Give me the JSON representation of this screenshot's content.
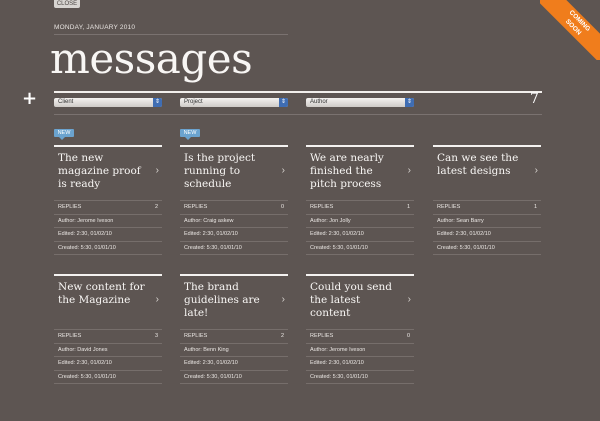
{
  "close_label": "CLOSE",
  "date": "MONDAY, JANUARY 2010",
  "title": "messages",
  "add_icon": "plus-icon",
  "filters": {
    "client": "Client",
    "project": "Project",
    "author": "Author"
  },
  "message_count": "7",
  "ribbon": {
    "line1": "COMING",
    "line2": "SOON"
  },
  "new_label": "NEW",
  "replies_label": "REPLIES",
  "cards": [
    {
      "title": "The new magazine proof is ready",
      "replies": "2",
      "author": "Author: Jerome Iveson",
      "edited": "Edited: 2:30, 01/02/10",
      "created": "Created: 5:30, 01/01/10",
      "is_new": true
    },
    {
      "title": "Is the project running to schedule",
      "replies": "0",
      "author": "Author: Craig askew",
      "edited": "Edited: 2:30, 01/02/10",
      "created": "Created: 5:30, 01/01/10",
      "is_new": true
    },
    {
      "title": "We are nearly finished the pitch process",
      "replies": "1",
      "author": "Author: Jon Jolly",
      "edited": "Edited: 2:30, 01/02/10",
      "created": "Created: 5:30, 01/01/10",
      "is_new": false
    },
    {
      "title": "Can we see the latest designs",
      "replies": "1",
      "author": "Author: Sean Barry",
      "edited": "Edited: 2:30, 01/02/10",
      "created": "Created: 5:30, 01/01/10",
      "is_new": false
    },
    {
      "title": "New content for the Magazine",
      "replies": "3",
      "author": "Author: David Jones",
      "edited": "Edited: 2:30, 01/02/10",
      "created": "Created: 5:30, 01/01/10",
      "is_new": false
    },
    {
      "title": "The brand guidelines are late!",
      "replies": "2",
      "author": "Author: Benn King",
      "edited": "Edited: 2:30, 01/02/10",
      "created": "Created: 5:30, 01/01/10",
      "is_new": false
    },
    {
      "title": "Could you send the latest content",
      "replies": "0",
      "author": "Author: Jerome Iveson",
      "edited": "Edited: 2:30, 01/02/10",
      "created": "Created: 5:30, 01/01/10",
      "is_new": false
    }
  ],
  "colors": {
    "background": "#5d5552",
    "accent_new": "#6ba3cf",
    "ribbon": "#f07d1c",
    "select_arrow": "#3f6db3"
  }
}
